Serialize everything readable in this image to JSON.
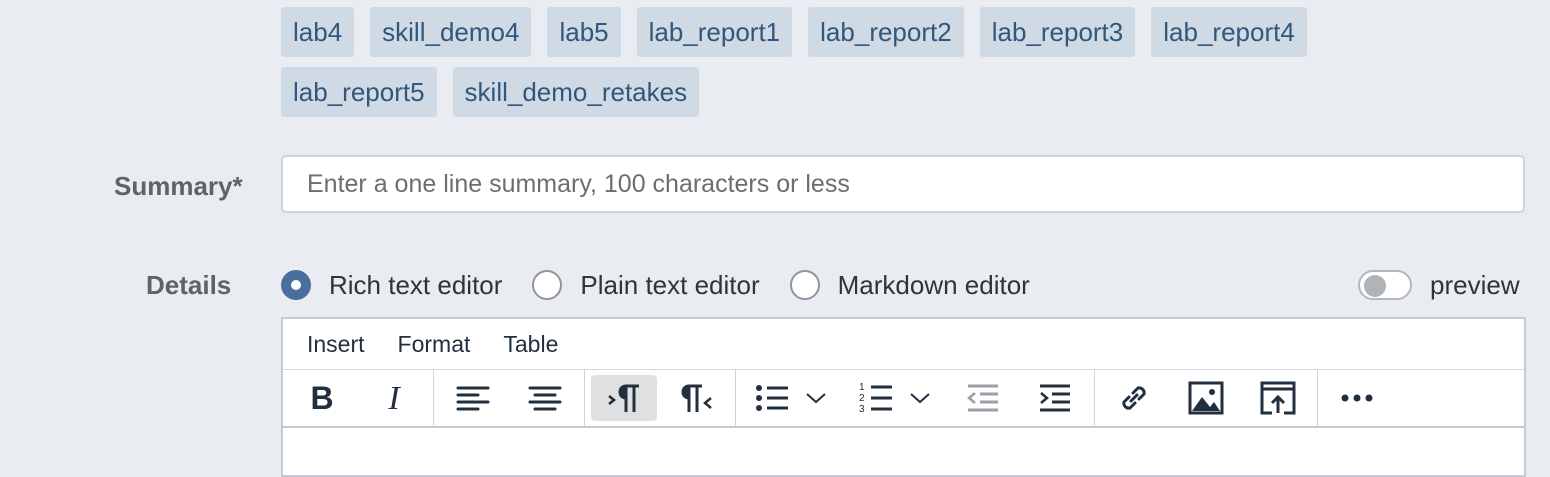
{
  "tags": [
    "lab4",
    "skill_demo4",
    "lab5",
    "lab_report1",
    "lab_report2",
    "lab_report3",
    "lab_report4",
    "lab_report5",
    "skill_demo_retakes"
  ],
  "summary": {
    "label": "Summary*",
    "placeholder": "Enter a one line summary, 100 characters or less",
    "value": ""
  },
  "details": {
    "label": "Details",
    "editors": [
      {
        "label": "Rich text editor",
        "selected": true
      },
      {
        "label": "Plain text editor",
        "selected": false
      },
      {
        "label": "Markdown editor",
        "selected": false
      }
    ],
    "preview_label": "preview",
    "preview_on": false
  },
  "editor": {
    "menu": [
      "Insert",
      "Format",
      "Table"
    ],
    "toolbar_icons": [
      "bold-icon",
      "italic-icon",
      "align-left-icon",
      "align-center-icon",
      "ltr-icon",
      "rtl-icon",
      "bullet-list-icon",
      "numbered-list-icon",
      "outdent-icon",
      "indent-icon",
      "link-icon",
      "image-icon",
      "embed-icon",
      "more-icon"
    ]
  },
  "colors": {
    "page_bg": "#e9ecf1",
    "tag_bg": "#cfdae5",
    "tag_text": "#31577c",
    "radio_selected": "#4a6f9c"
  }
}
